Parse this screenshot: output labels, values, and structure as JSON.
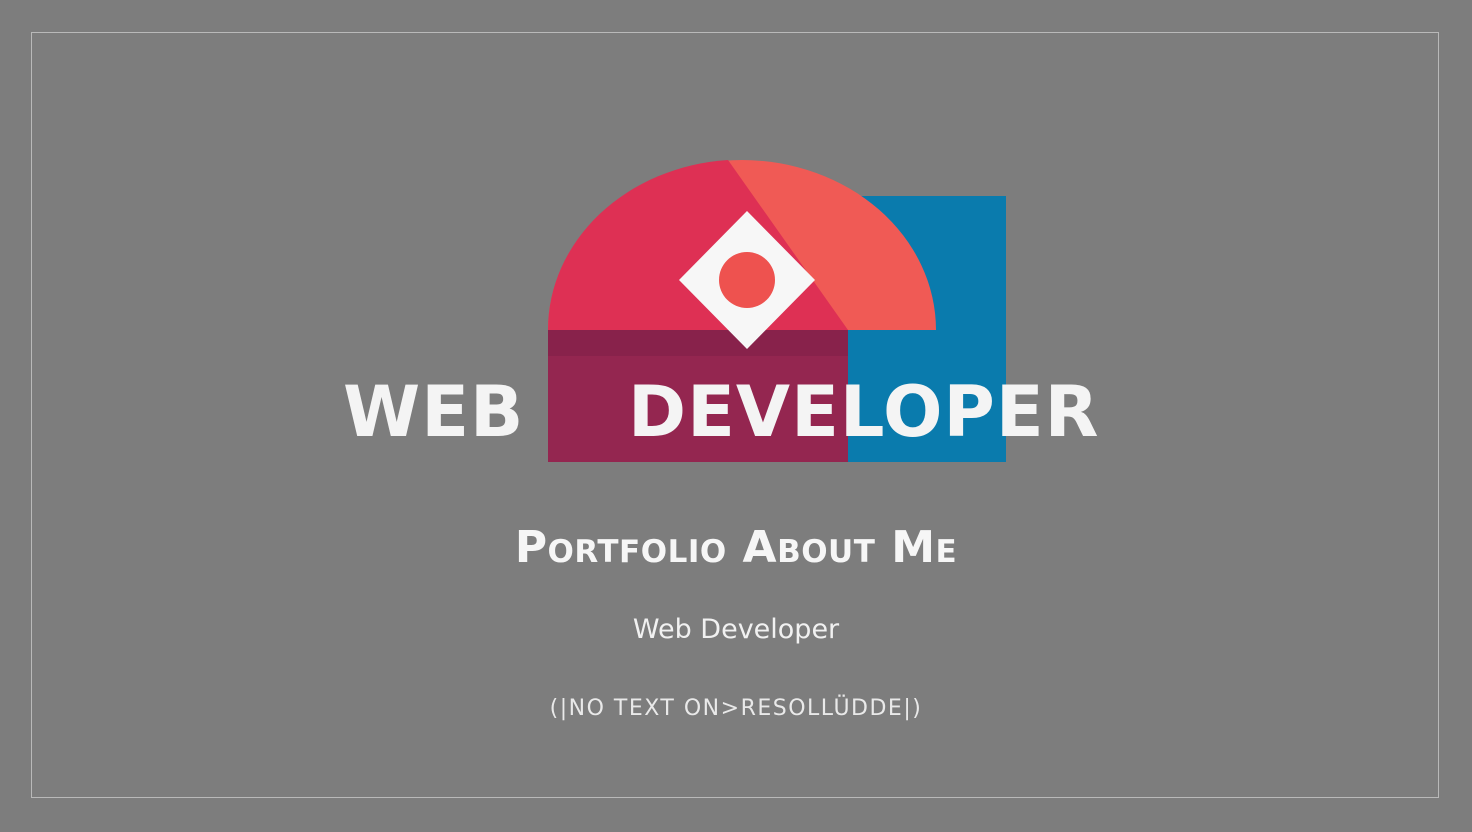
{
  "logo": {
    "word_left": "WEB",
    "word_right": "DEVELOPER",
    "colors": {
      "crimson": "#de3054",
      "coral": "#f05a55",
      "maroon": "#942650",
      "blue": "#0a7bad",
      "white": "#f7f7f7",
      "dot": "#ee524f"
    }
  },
  "heading": "Portfolio About Me",
  "subheading": "Web Developer",
  "note": "(|NO TEXT ON>RESOLLÜDDE|)",
  "background": "#7d7d7d"
}
